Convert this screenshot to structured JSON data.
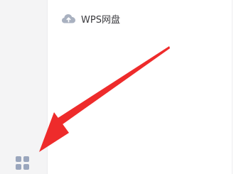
{
  "sidebar": {
    "items": [
      {
        "label": "WPS网盘",
        "icon": "cloud-icon"
      }
    ],
    "bottom_button": {
      "icon": "apps-grid-icon"
    }
  },
  "annotation": {
    "type": "arrow",
    "color": "#ee2b2b",
    "points_to": "apps-grid-button"
  },
  "colors": {
    "rail_bg": "#f4f4f5",
    "icon_gray": "#a9b1c0",
    "apps_icon": "#9aa6bd",
    "text": "#3a3a3e"
  }
}
